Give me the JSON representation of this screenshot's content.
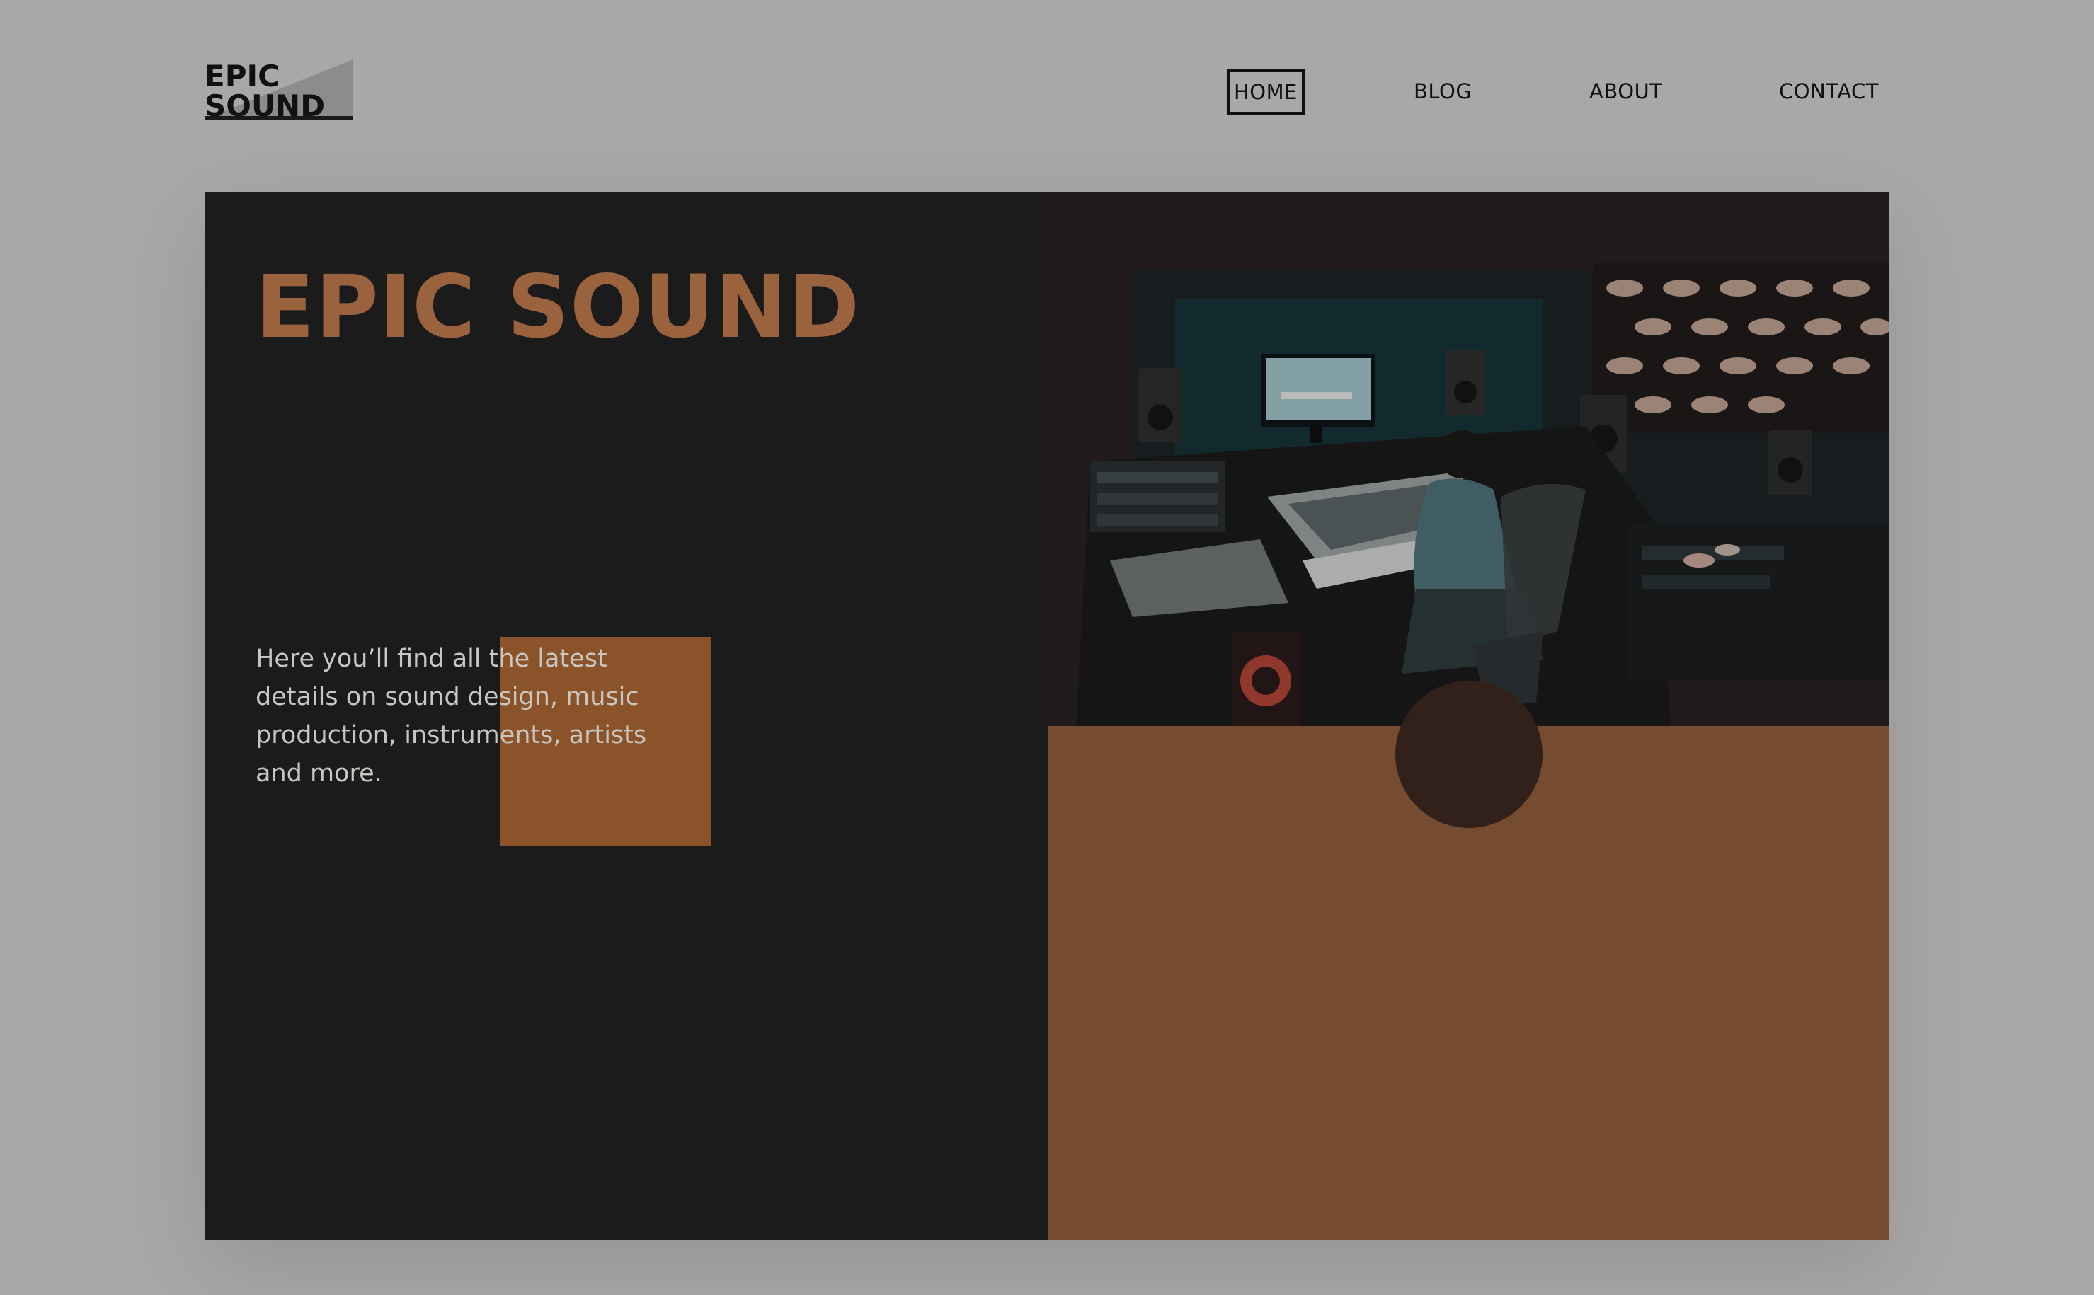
{
  "logo": {
    "line1": "EPIC",
    "line2": "SOUND"
  },
  "nav": {
    "items": [
      {
        "label": "HOME",
        "active": true
      },
      {
        "label": "BLOG",
        "active": false
      },
      {
        "label": "ABOUT",
        "active": false
      },
      {
        "label": "CONTACT",
        "active": false
      }
    ]
  },
  "hero": {
    "title": "EPIC SOUND",
    "description": "Here you’ll find all the latest details on sound design, music production, instruments, artists and more.",
    "photo_subject": "recording-studio-photo"
  },
  "colors": {
    "page_background": "#a8a8a8",
    "panel_dark": "#1b1b1c",
    "title_brown": "#9a633e",
    "accent_orange": "#8b5329",
    "panel_brown": "#764c30",
    "circle_dark": "#32201a",
    "text_light": "#c9c6c2"
  }
}
